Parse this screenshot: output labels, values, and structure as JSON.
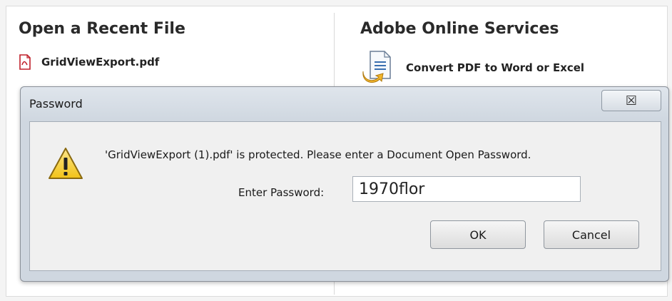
{
  "recent": {
    "title": "Open a Recent File",
    "items": [
      {
        "label": "GridViewExport.pdf",
        "icon": "pdf-file-icon"
      }
    ]
  },
  "services": {
    "title": "Adobe Online Services",
    "items": [
      {
        "label": "Convert PDF to Word or Excel",
        "icon": "convert-document-icon"
      }
    ]
  },
  "dialog": {
    "title": "Password",
    "close_label": "☒",
    "message": "'GridViewExport (1).pdf' is protected. Please enter a Document Open Password.",
    "password_label": "Enter Password:",
    "password_value": "1970flor",
    "ok_label": "OK",
    "cancel_label": "Cancel",
    "warning_icon": "warning-icon"
  },
  "colors": {
    "warning_yellow": "#f2c318",
    "pdf_red": "#c0202a"
  }
}
